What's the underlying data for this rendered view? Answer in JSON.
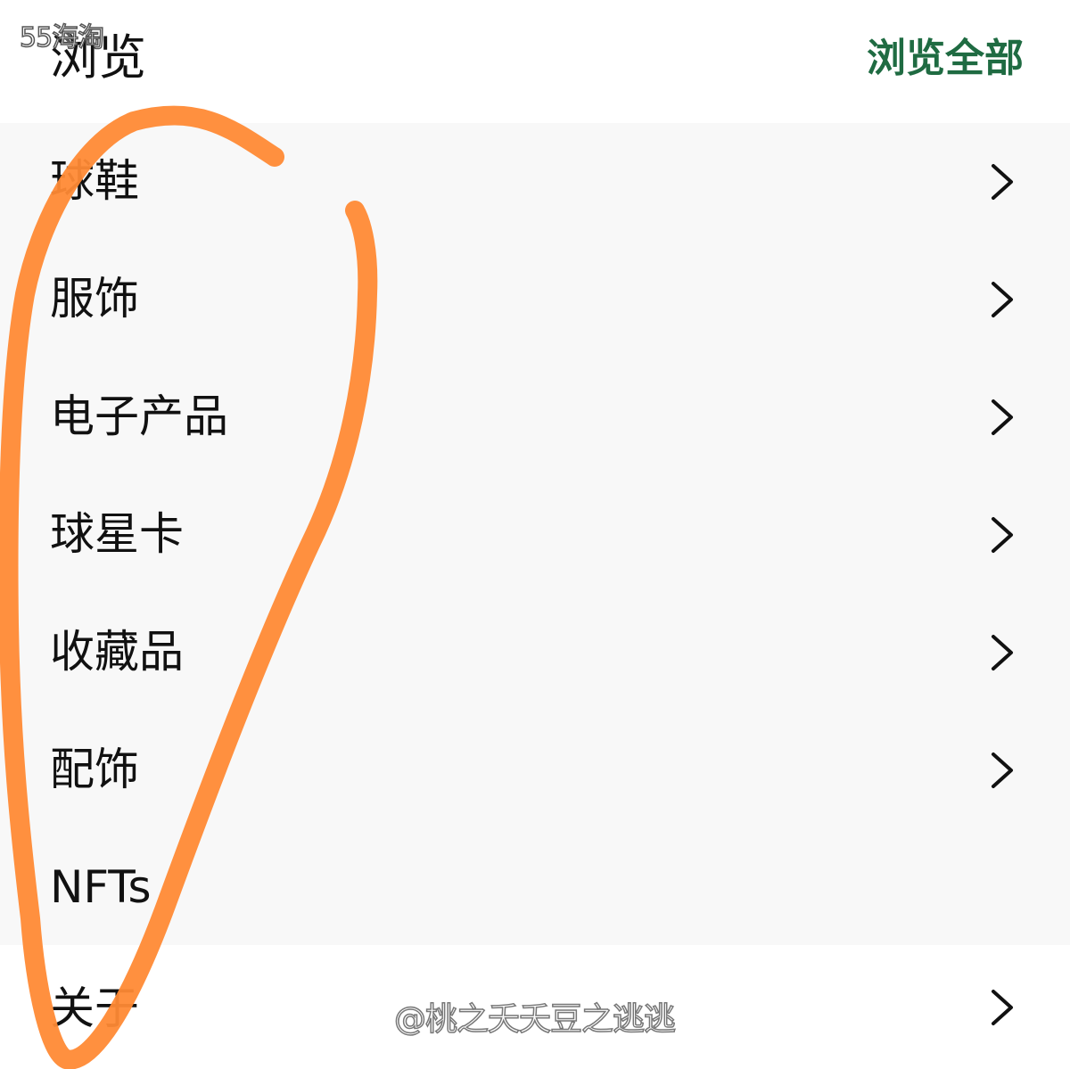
{
  "header": {
    "title": "浏览",
    "browse_all": "浏览全部"
  },
  "source_mark": "55海淘",
  "categories": [
    {
      "label": "球鞋"
    },
    {
      "label": "服饰"
    },
    {
      "label": "电子产品"
    },
    {
      "label": "球星卡"
    },
    {
      "label": "收藏品"
    },
    {
      "label": "配饰"
    },
    {
      "label": "NFTs"
    }
  ],
  "about": {
    "label": "关于"
  },
  "watermark": "@桃之夭夭豆之逃逃",
  "icons": {
    "chevron": "chevron-right-icon"
  },
  "colors": {
    "accent": "#1f6b42",
    "list_background": "#f8f8f8",
    "annotation_stroke": "#ff8a35"
  }
}
